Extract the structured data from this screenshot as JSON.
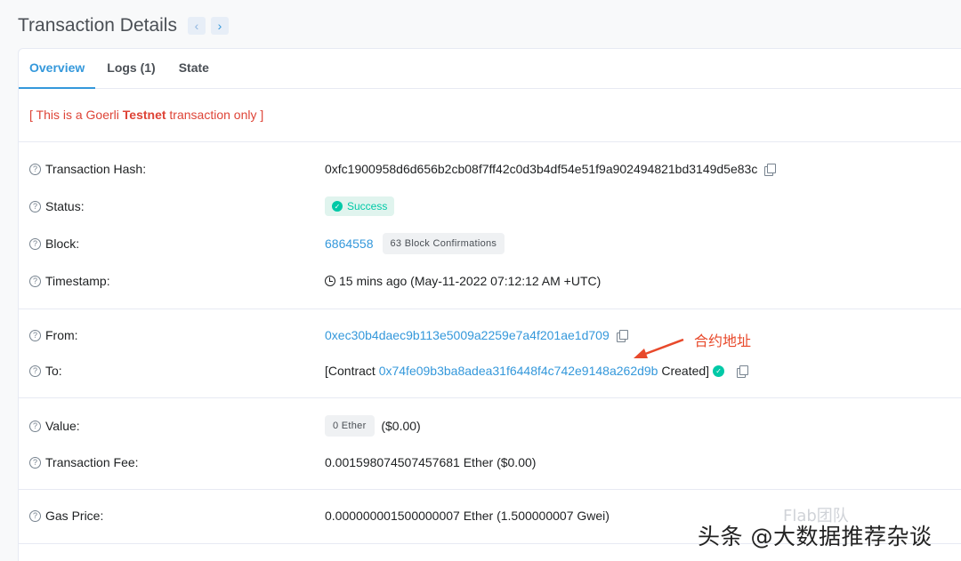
{
  "header": {
    "title": "Transaction Details",
    "prev_icon": "‹",
    "next_icon": "›"
  },
  "tabs": [
    {
      "label": "Overview",
      "active": true
    },
    {
      "label": "Logs (1)",
      "active": false
    },
    {
      "label": "State",
      "active": false
    }
  ],
  "testnet_notice": {
    "prefix": "[ This is a Goerli ",
    "bold": "Testnet",
    "suffix": " transaction only ]"
  },
  "fields": {
    "tx_hash": {
      "label": "Transaction Hash:",
      "value": "0xfc1900958d6d656b2cb08f7ff42c0d3b4df54e51f9a902494821bd3149d5e83c"
    },
    "status": {
      "label": "Status:",
      "value": "Success"
    },
    "block": {
      "label": "Block:",
      "value": "6864558",
      "confirmations": "63 Block Confirmations"
    },
    "timestamp": {
      "label": "Timestamp:",
      "value": "15 mins ago (May-11-2022 07:12:12 AM +UTC)"
    },
    "from": {
      "label": "From:",
      "value": "0xec30b4daec9b113e5009a2259e7a4f201ae1d709"
    },
    "to": {
      "label": "To:",
      "prefix": "[Contract ",
      "address": "0x74fe09b3ba8adea31f6448f4c742e9148a262d9b",
      "suffix": " Created]"
    },
    "value": {
      "label": "Value:",
      "amount": "0 Ether",
      "usd": "($0.00)"
    },
    "fee": {
      "label": "Transaction Fee:",
      "value": "0.001598074507457681 Ether ($0.00)"
    },
    "gas_price": {
      "label": "Gas Price:",
      "value": "0.000000001500000007 Ether (1.500000007 Gwei)"
    }
  },
  "annotation": {
    "text": "合约地址"
  },
  "watermark": {
    "text": "头条 @大数据推荐杂谈",
    "faint": "Flab团队"
  },
  "colors": {
    "link": "#3498db",
    "success": "#00c9a7",
    "testnet": "#de4437",
    "annotation": "#e8492b"
  }
}
